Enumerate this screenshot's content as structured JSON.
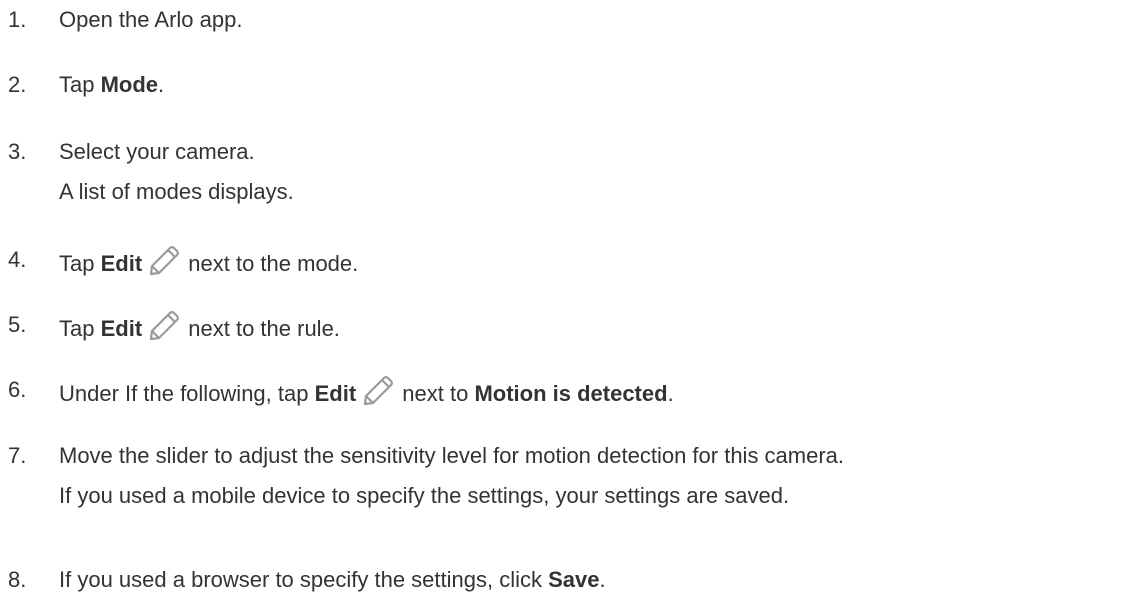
{
  "steps": [
    {
      "number": "1.",
      "lines": [
        [
          "Open the Arlo app."
        ]
      ]
    },
    {
      "number": "2.",
      "lines": [
        [
          "Tap ",
          "Mode",
          "."
        ]
      ]
    },
    {
      "number": "3.",
      "lines": [
        [
          "Select your camera."
        ],
        [
          "A list of modes displays."
        ]
      ]
    },
    {
      "number": "4.",
      "lines": [
        [
          "Tap ",
          "Edit",
          " next to the mode."
        ]
      ]
    },
    {
      "number": "5.",
      "lines": [
        [
          "Tap ",
          "Edit",
          " next to the rule."
        ]
      ]
    },
    {
      "number": "6.",
      "lines": [
        [
          "Under If the following, tap ",
          "Edit",
          " next to ",
          "Motion is detected",
          "."
        ]
      ]
    },
    {
      "number": "7.",
      "lines": [
        [
          "Move the slider to adjust the sensitivity level for motion detection for this camera."
        ],
        [
          "If you used a mobile device to specify the settings, your settings are saved."
        ]
      ]
    },
    {
      "number": "8.",
      "lines": [
        [
          "If you used a browser to specify the settings, click ",
          "Save",
          "."
        ]
      ]
    }
  ],
  "icons": {
    "edit": "pencil-edit-icon"
  },
  "colors": {
    "text": "#333333",
    "icon_stroke": "#9a9a9a"
  }
}
